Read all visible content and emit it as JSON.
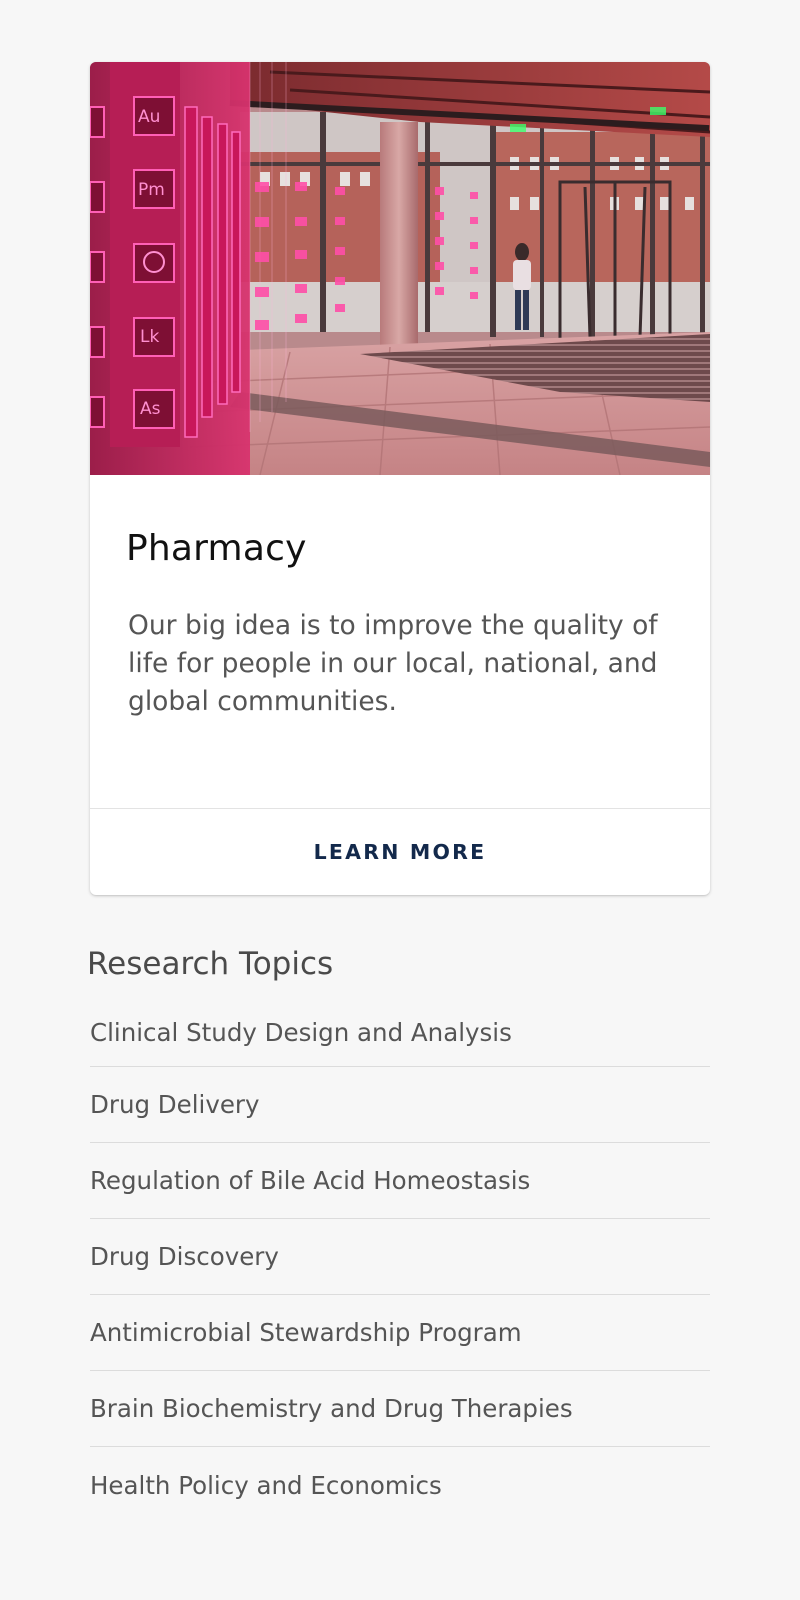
{
  "card": {
    "image_alt": "Pharmacy building lobby with neon element displays",
    "image_neon_labels": [
      "Au",
      "Pm",
      "Lk",
      "As"
    ],
    "title": "Pharmacy",
    "description": "Our big idea is to improve the quality of life for people in our local, national, and global communities.",
    "cta_label": "LEARN MORE"
  },
  "research": {
    "heading": "Research Topics",
    "topics": [
      "Clinical Study Design and Analysis",
      "Drug Delivery",
      "Regulation of Bile Acid Homeostasis",
      "Drug Discovery",
      "Antimicrobial Stewardship Program",
      "Brain Biochemistry and Drug Therapies",
      "Health Policy and Economics"
    ]
  },
  "colors": {
    "page_background": "#f7f7f7",
    "cta_text": "#13294b",
    "neon_pink": "#ff3fae"
  }
}
